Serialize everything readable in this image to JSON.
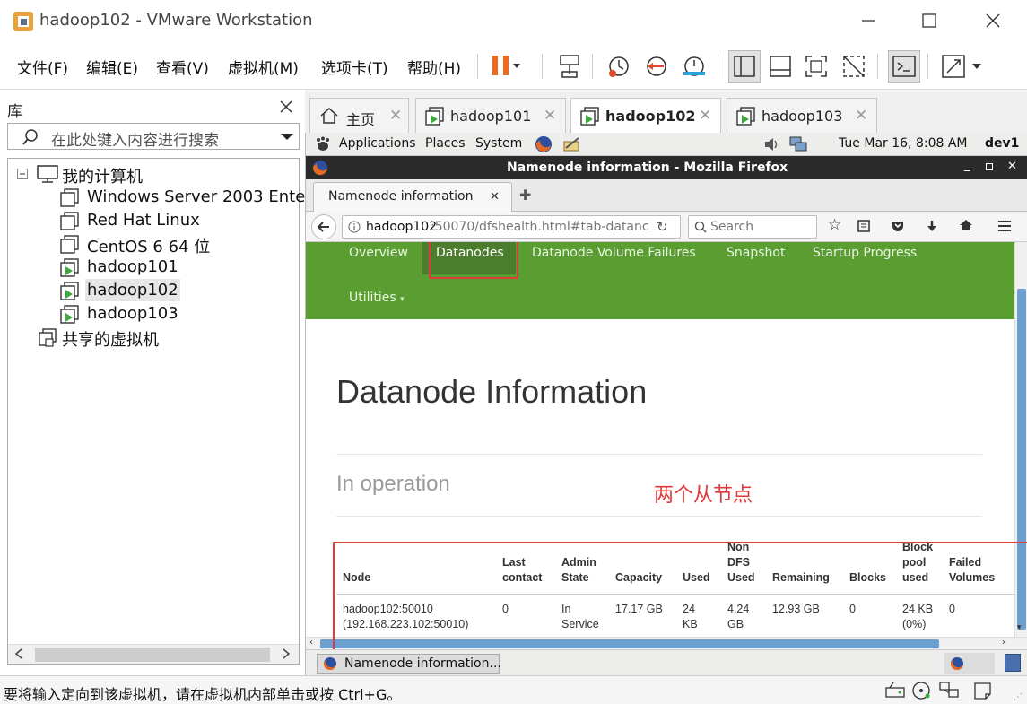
{
  "window": {
    "title": "hadoop102 - VMware Workstation"
  },
  "menu": {
    "items": [
      "文件(F)",
      "编辑(E)",
      "查看(V)",
      "虚拟机(M)",
      "选项卡(T)",
      "帮助(H)"
    ]
  },
  "library": {
    "title": "库",
    "search_placeholder": "在此处键入内容进行搜索",
    "root": "我的计算机",
    "vms": [
      "Windows Server 2003 Enter",
      "Red Hat Linux",
      "CentOS 6 64 位",
      "hadoop101",
      "hadoop102",
      "hadoop103"
    ],
    "shared": "共享的虚拟机",
    "selected": "hadoop102"
  },
  "vm_tabs": [
    {
      "label": "主页",
      "icon": "home-icon"
    },
    {
      "label": "hadoop101",
      "icon": "vm-icon"
    },
    {
      "label": "hadoop102",
      "icon": "vm-icon",
      "active": true
    },
    {
      "label": "hadoop103",
      "icon": "vm-icon"
    }
  ],
  "guest_panel": {
    "applications": "Applications",
    "places": "Places",
    "system": "System",
    "clock": "Tue Mar 16,  8:08 AM",
    "user": "dev1"
  },
  "firefox": {
    "window_title": "Namenode information - Mozilla Firefox",
    "tab_title": "Namenode information",
    "url_host": "hadoop102",
    "url_rest": ":50070/dfshealth.html#tab-datanc",
    "search_placeholder": "Search"
  },
  "page": {
    "nav": {
      "overview": "Overview",
      "datanodes": "Datanodes",
      "volume_failures": "Datanode Volume Failures",
      "snapshot": "Snapshot",
      "startup": "Startup Progress",
      "utilities": "Utilities"
    },
    "active_nav": "Datanodes",
    "heading": "Datanode Information",
    "subheading": "In operation",
    "annotation": "两个从节点",
    "table": {
      "headers": {
        "node": "Node",
        "last_contact_1": "Last",
        "last_contact_2": "contact",
        "admin_1": "Admin",
        "admin_2": "State",
        "capacity": "Capacity",
        "used": "Used",
        "nondfs_1": "Non",
        "nondfs_2": "DFS",
        "nondfs_3": "Used",
        "remaining": "Remaining",
        "blocks": "Blocks",
        "pool_1": "Block",
        "pool_2": "pool",
        "pool_3": "used",
        "failed_1": "Failed",
        "failed_2": "Volumes"
      },
      "rows": [
        {
          "node_1": "hadoop102:50010",
          "node_2": "(192.168.223.102:50010)",
          "last_contact": "0",
          "admin_1": "In",
          "admin_2": "Service",
          "capacity": "17.17 GB",
          "used_1": "24",
          "used_2": "KB",
          "nondfs_1": "4.24",
          "nondfs_2": "GB",
          "remaining": "12.93 GB",
          "blocks": "0",
          "pool_1": "24 KB",
          "pool_2": "(0%)",
          "failed": "0"
        }
      ]
    }
  },
  "taskbar": {
    "task": "Namenode information..."
  },
  "status": {
    "text": "要将输入定向到该虚拟机，请在虚拟机内部单击或按 Ctrl+G。"
  },
  "colors": {
    "hadoop_nav": "#5a9e32",
    "highlight": "#e03a3a",
    "firefox_title": "#2b2b2b"
  }
}
